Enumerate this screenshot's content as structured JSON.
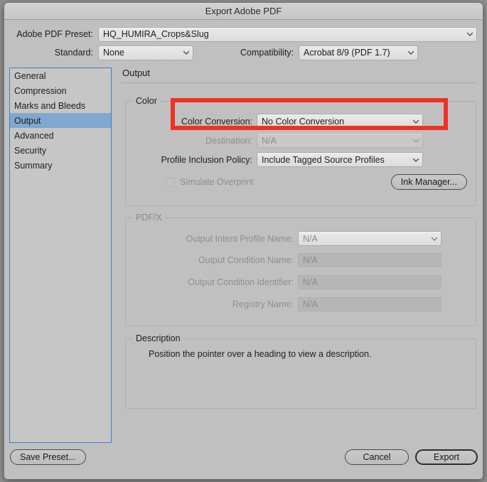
{
  "window": {
    "title": "Export Adobe PDF"
  },
  "top": {
    "preset_label": "Adobe PDF Preset:",
    "preset_value": "HQ_HUMIRA_Crops&Slug",
    "standard_label": "Standard:",
    "standard_value": "None",
    "compatibility_label": "Compatibility:",
    "compatibility_value": "Acrobat 8/9 (PDF 1.7)"
  },
  "sidebar": {
    "items": [
      {
        "label": "General",
        "selected": false
      },
      {
        "label": "Compression",
        "selected": false
      },
      {
        "label": "Marks and Bleeds",
        "selected": false
      },
      {
        "label": "Output",
        "selected": true
      },
      {
        "label": "Advanced",
        "selected": false
      },
      {
        "label": "Security",
        "selected": false
      },
      {
        "label": "Summary",
        "selected": false
      }
    ]
  },
  "pane": {
    "title": "Output",
    "color_group": {
      "title": "Color",
      "color_conversion_label": "Color Conversion:",
      "color_conversion_value": "No Color Conversion",
      "destination_label": "Destination:",
      "destination_value": "N/A",
      "profile_policy_label": "Profile Inclusion Policy:",
      "profile_policy_value": "Include Tagged Source Profiles",
      "simulate_overprint_label": "Simulate Overprint",
      "ink_manager_label": "Ink Manager..."
    },
    "pdfx_group": {
      "title": "PDF/X",
      "intent_profile_label": "Output Intent Profile Name:",
      "intent_profile_value": "N/A",
      "condition_name_label": "Output Condition Name:",
      "condition_name_value": "N/A",
      "condition_id_label": "Output Condition Identifier:",
      "condition_id_value": "N/A",
      "registry_name_label": "Registry Name:",
      "registry_name_value": "N/A"
    },
    "description_group": {
      "title": "Description",
      "text": "Position the pointer over a heading to view a description."
    }
  },
  "footer": {
    "save_preset_label": "Save Preset...",
    "cancel_label": "Cancel",
    "export_label": "Export"
  },
  "annotation": {
    "highlight_color": "#ef3124"
  },
  "colors": {
    "dialog_background": "#c0c0c0",
    "titlebar": "#cdcdcd",
    "selection_blue": "#80a8d0",
    "focus_border": "#3d7fd0"
  }
}
